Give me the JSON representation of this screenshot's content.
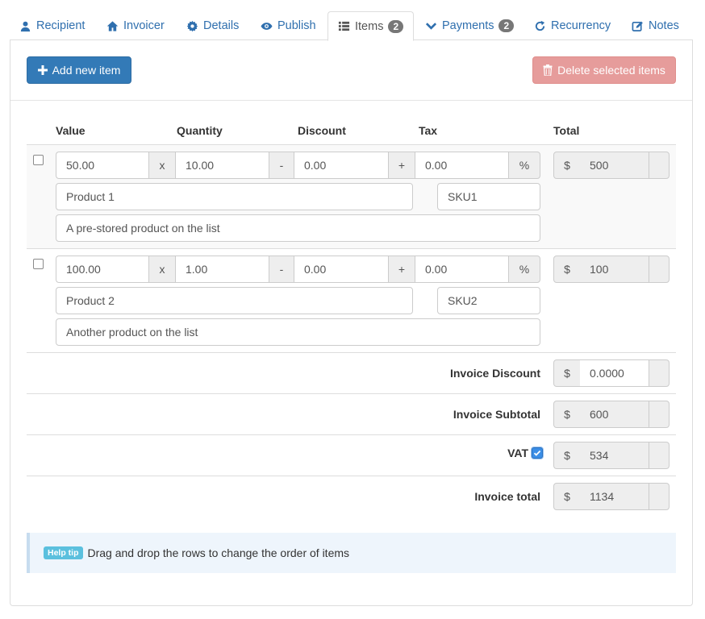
{
  "tabs": [
    {
      "label": "Recipient",
      "icon": "user-icon"
    },
    {
      "label": "Invoicer",
      "icon": "home-icon"
    },
    {
      "label": "Details",
      "icon": "gear-icon"
    },
    {
      "label": "Publish",
      "icon": "eye-icon"
    },
    {
      "label": "Items",
      "icon": "list-icon",
      "badge": "2",
      "active": true
    },
    {
      "label": "Payments",
      "icon": "chevron-down-icon",
      "badge": "2"
    },
    {
      "label": "Recurrency",
      "icon": "refresh-icon"
    },
    {
      "label": "Notes",
      "icon": "edit-icon"
    }
  ],
  "toolbar": {
    "add_label": "Add new item",
    "delete_label": "Delete selected items"
  },
  "columns": {
    "value": "Value",
    "quantity": "Quantity",
    "discount": "Discount",
    "tax": "Tax",
    "total": "Total"
  },
  "symbols": {
    "times": "x",
    "minus": "-",
    "plus": "+",
    "percent": "%",
    "currency": "$"
  },
  "items": [
    {
      "value": "50.00",
      "quantity": "10.00",
      "discount": "0.00",
      "tax": "0.00",
      "total": "500",
      "name": "Product 1",
      "sku": "SKU1",
      "description": "A pre-stored product on the list",
      "selected": false
    },
    {
      "value": "100.00",
      "quantity": "1.00",
      "discount": "0.00",
      "tax": "0.00",
      "total": "100",
      "name": "Product 2",
      "sku": "SKU2",
      "description": "Another product on the list",
      "selected": false
    }
  ],
  "summary": {
    "discount_label": "Invoice Discount",
    "discount_value": "0.0000",
    "subtotal_label": "Invoice Subtotal",
    "subtotal_value": "600",
    "vat_label": "VAT",
    "vat_checked": true,
    "vat_value": "534",
    "total_label": "Invoice total",
    "total_value": "1134"
  },
  "help": {
    "badge": "Help tip",
    "text": "Drag and drop the rows to change the order of items"
  },
  "colors": {
    "primary": "#337ab7",
    "danger": "#e69c9b",
    "link": "#2f6fae",
    "badge": "#777777",
    "help_badge": "#5bc0de"
  }
}
